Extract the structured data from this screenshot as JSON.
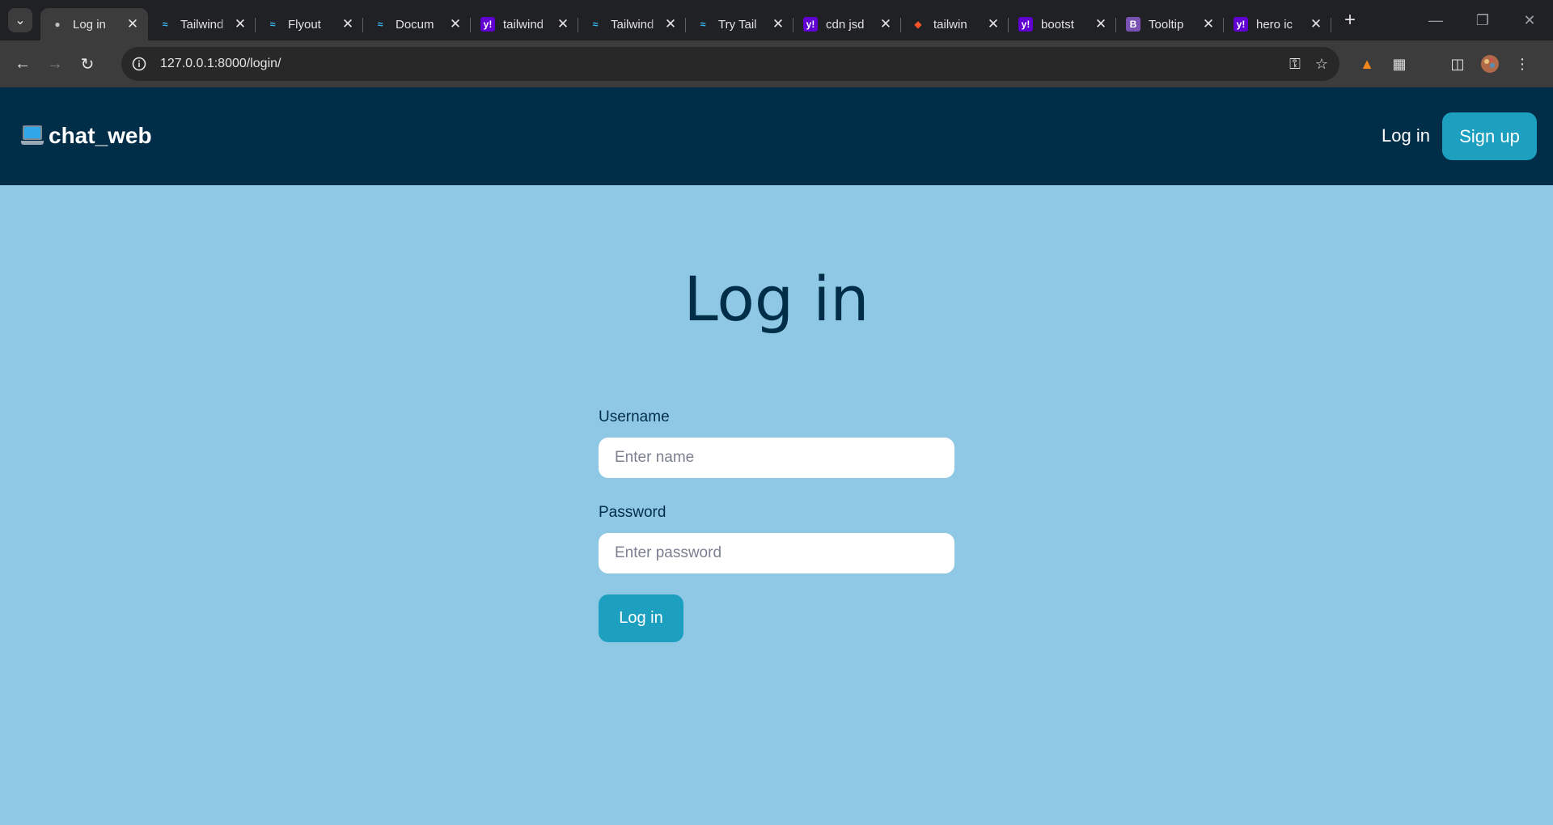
{
  "browser": {
    "tabs": [
      {
        "title": "Log in",
        "icon": "globe-icon",
        "active": true
      },
      {
        "title": "Tailwind",
        "icon": "tailwind-icon"
      },
      {
        "title": "Flyout",
        "icon": "tailwind-icon"
      },
      {
        "title": "Docum",
        "icon": "tailwind-icon"
      },
      {
        "title": "tailwind",
        "icon": "yahoo-icon"
      },
      {
        "title": "Tailwind",
        "icon": "tailwind-icon"
      },
      {
        "title": "Try Tail",
        "icon": "tailwind-icon"
      },
      {
        "title": "cdn jsd",
        "icon": "yahoo-icon"
      },
      {
        "title": "tailwin",
        "icon": "brave-icon"
      },
      {
        "title": "bootst",
        "icon": "yahoo-icon"
      },
      {
        "title": "Tooltip",
        "icon": "bootstrap-icon"
      },
      {
        "title": "hero ic",
        "icon": "yahoo-icon"
      }
    ],
    "url": "127.0.0.1:8000/login/"
  },
  "header": {
    "brand": "chat_web",
    "login_label": "Log in",
    "signup_label": "Sign up"
  },
  "main": {
    "title": "Log in",
    "username_label": "Username",
    "username_placeholder": "Enter name",
    "password_label": "Password",
    "password_placeholder": "Enter password",
    "submit_label": "Log in"
  },
  "colors": {
    "page_bg": "#8ec8e5",
    "header_bg": "#002d48",
    "accent": "#1d9fc0"
  }
}
